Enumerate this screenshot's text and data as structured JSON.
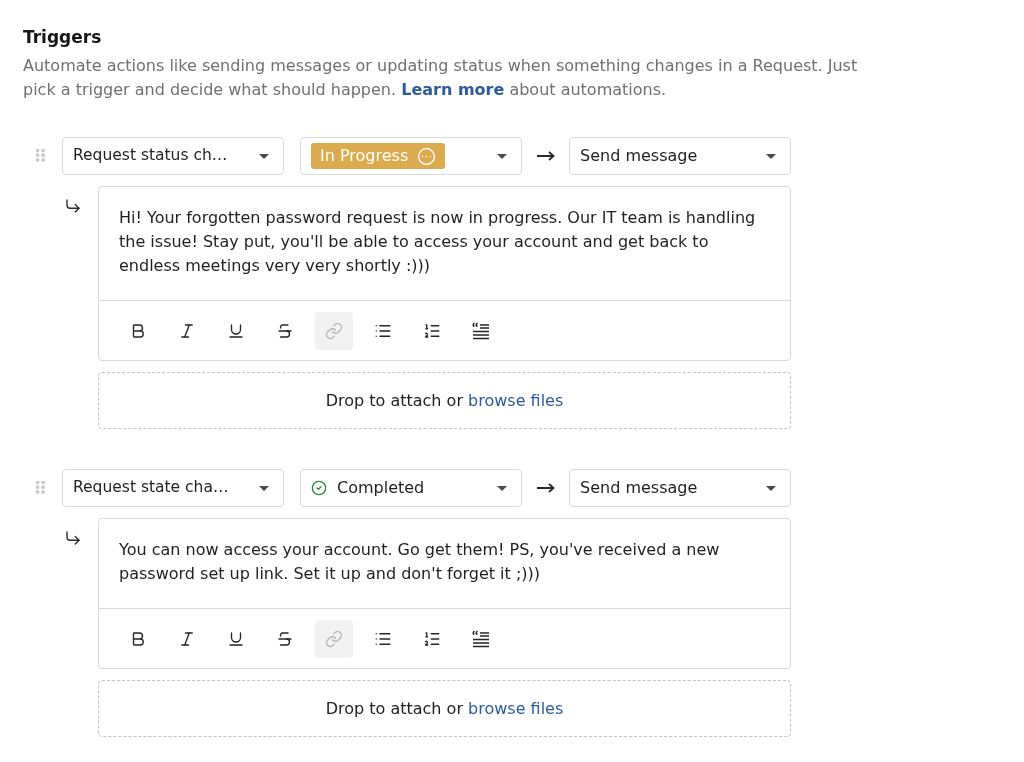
{
  "section": {
    "title": "Triggers",
    "description": {
      "before": "Automate actions like sending messages or updating status when something changes in a Request. Just pick a trigger and decide what should happen.",
      "link": "Learn more",
      "after": "about automations."
    }
  },
  "triggers": [
    {
      "event": "Request status ch…",
      "status": {
        "label": "In Progress",
        "kind": "badge",
        "color": "#dcab4f"
      },
      "action": "Send message",
      "message": "Hi! Your forgotten password request is now in progress. Our IT team is handling the issue! Stay put, you'll be able to access your account and get back to endless meetings very very shortly :)))",
      "toolbar": [
        {
          "kind": "bold",
          "disabled": false
        },
        {
          "kind": "italic",
          "disabled": false
        },
        {
          "kind": "underline",
          "disabled": false
        },
        {
          "kind": "strikethrough",
          "disabled": false
        },
        {
          "kind": "link",
          "disabled": true
        },
        {
          "kind": "bullets",
          "disabled": false
        },
        {
          "kind": "numbers",
          "disabled": false
        },
        {
          "kind": "quote",
          "disabled": false
        }
      ],
      "attach": {
        "text": "Drop to attach or",
        "link": "browse files"
      }
    },
    {
      "event": "Request state cha…",
      "status": {
        "label": "Completed",
        "kind": "icon",
        "color": "#2f8a3c"
      },
      "action": "Send message",
      "message": "You can now access your account. Go get them! PS, you've received a new password set up link. Set it up and don't forget it ;)))",
      "toolbar": [
        {
          "kind": "bold",
          "disabled": false
        },
        {
          "kind": "italic",
          "disabled": false
        },
        {
          "kind": "underline",
          "disabled": false
        },
        {
          "kind": "strikethrough",
          "disabled": false
        },
        {
          "kind": "link",
          "disabled": true
        },
        {
          "kind": "bullets",
          "disabled": false
        },
        {
          "kind": "numbers",
          "disabled": false
        },
        {
          "kind": "quote",
          "disabled": false
        }
      ],
      "attach": {
        "text": "Drop to attach or",
        "link": "browse files"
      }
    }
  ]
}
